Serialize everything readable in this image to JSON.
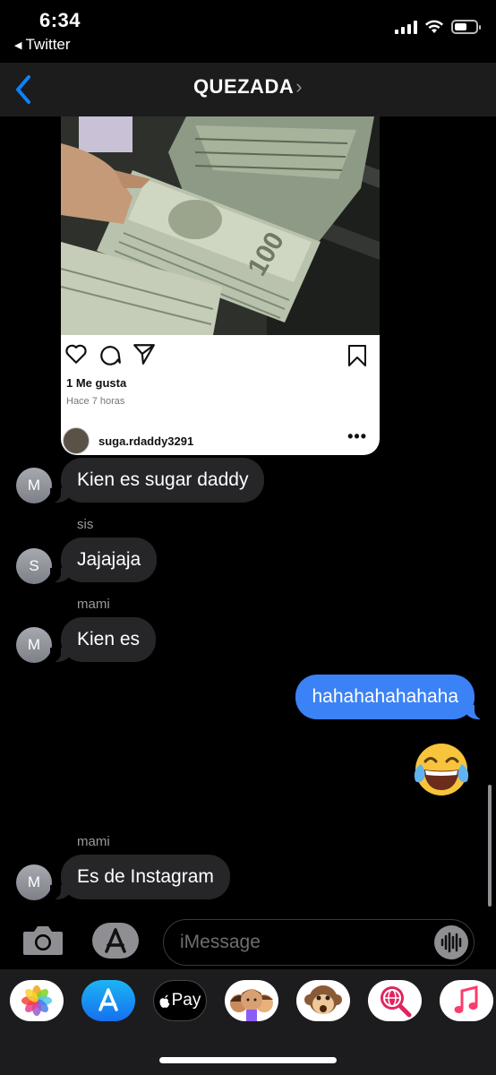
{
  "status_bar": {
    "time": "6:34",
    "back_app_label": "Twitter"
  },
  "header": {
    "title": "QUEZADA",
    "title_chevron": "›"
  },
  "post": {
    "likes": "1 Me gusta",
    "time_ago": "Hace 7 horas",
    "username": "suga.rdaddy3291",
    "more": "•••"
  },
  "messages": [
    {
      "sender": "",
      "avatar_initial": "M",
      "text": "Kien es sugar daddy"
    },
    {
      "sender": "sis",
      "avatar_initial": "S",
      "text": "Jajajaja"
    },
    {
      "sender": "mami",
      "avatar_initial": "M",
      "text": "Kien es"
    },
    {
      "text": "hahahahahahaha"
    },
    {
      "text": "😂"
    },
    {
      "sender": "mami",
      "avatar_initial": "M",
      "text": "Es de Instagram"
    }
  ],
  "composer": {
    "placeholder": "iMessage"
  },
  "app_drawer": [
    {
      "name": "photos-app-icon"
    },
    {
      "name": "app-store-icon"
    },
    {
      "name": "apple-pay-icon",
      "label": "Pay"
    },
    {
      "name": "memoji-icon"
    },
    {
      "name": "animoji-monkey-icon"
    },
    {
      "name": "web-search-icon"
    },
    {
      "name": "music-icon"
    }
  ],
  "colors": {
    "outgoing_bubble": "#3b82f6",
    "incoming_bubble": "#262628",
    "accent": "#0a84ff"
  }
}
